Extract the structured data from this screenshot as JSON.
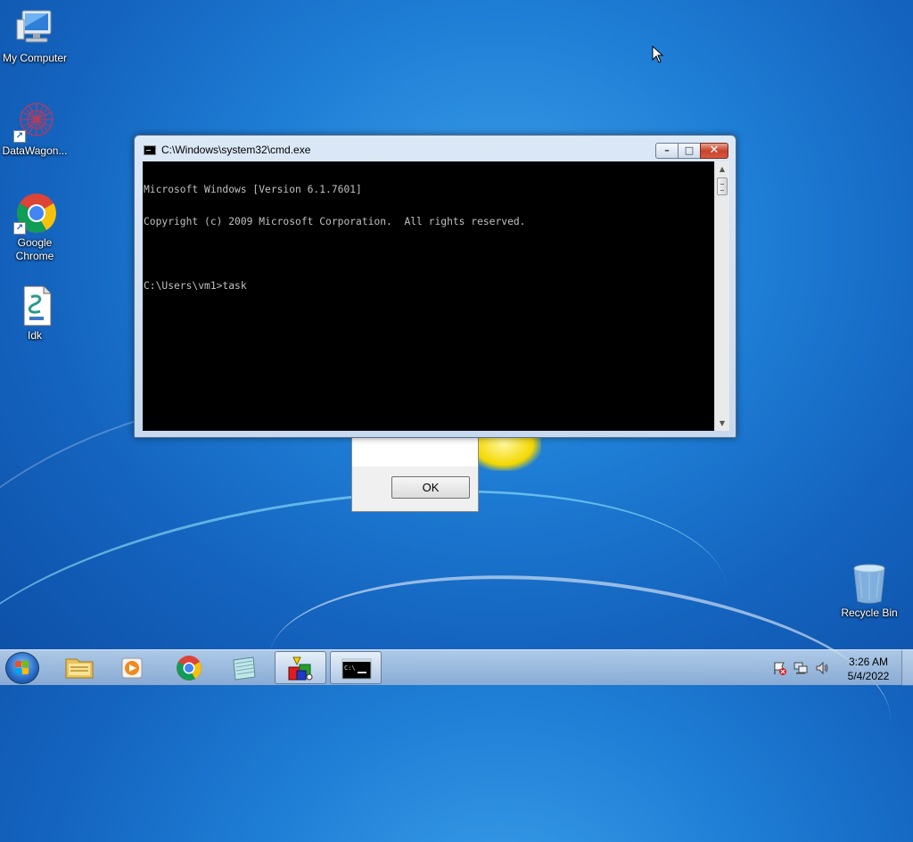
{
  "desktop": {
    "icons": [
      {
        "label": "My Computer"
      },
      {
        "label": "DataWagon..."
      },
      {
        "label": "Google Chrome"
      },
      {
        "label": "Idk"
      },
      {
        "label": "Recycle Bin"
      }
    ]
  },
  "message_box": {
    "ok_label": "OK"
  },
  "cmd_window": {
    "title": "C:\\Windows\\system32\\cmd.exe",
    "lines": [
      "Microsoft Windows [Version 6.1.7601]",
      "Copyright (c) 2009 Microsoft Corporation.  All rights reserved.",
      "",
      "C:\\Users\\vm1>task"
    ],
    "buttons": {
      "minimize": "minimize-icon",
      "maximize": "maximize-icon",
      "close": "close-icon"
    }
  },
  "taskbar": {
    "pinned": [
      {
        "name": "file-explorer-icon"
      },
      {
        "name": "media-player-icon"
      },
      {
        "name": "chrome-icon"
      },
      {
        "name": "notepad-icon"
      },
      {
        "name": "app-shapes-icon"
      },
      {
        "name": "cmd-icon"
      }
    ],
    "clock": {
      "time": "3:26 AM",
      "date": "5/4/2022"
    }
  },
  "colors": {
    "console_bg": "#000000",
    "console_fg": "#c0c0c0",
    "close_button": "#c7422b"
  }
}
